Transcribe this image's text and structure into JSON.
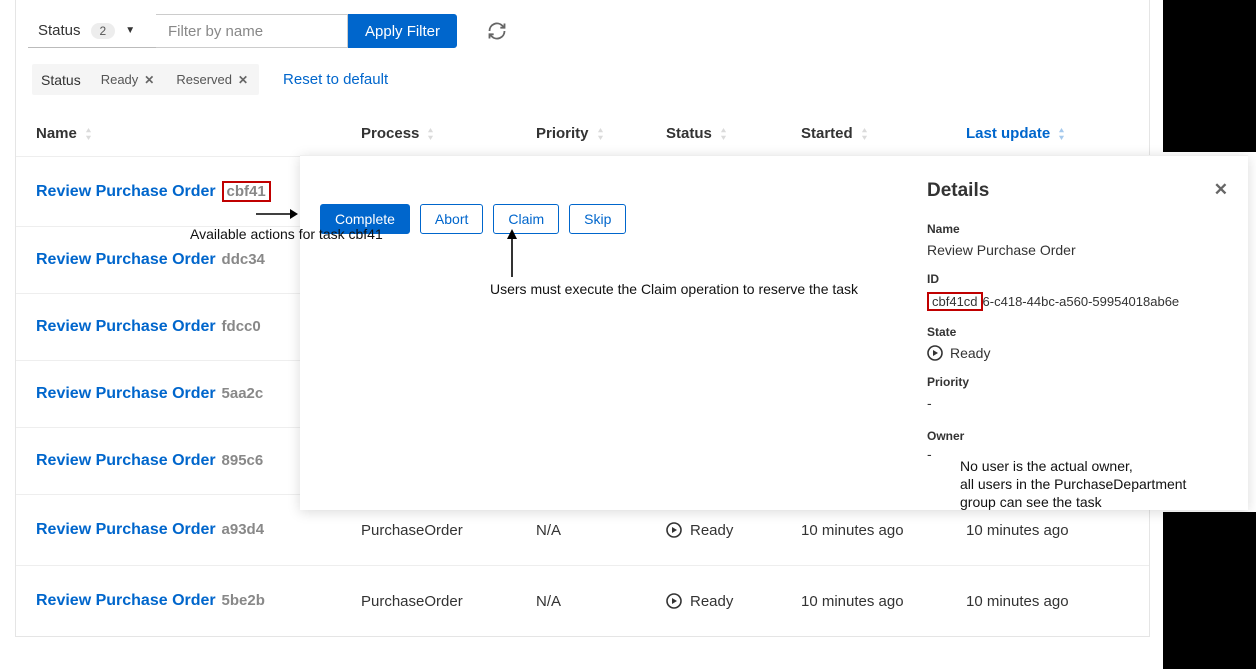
{
  "filters": {
    "status_label": "Status",
    "status_count": "2",
    "name_placeholder": "Filter by name",
    "apply_label": "Apply Filter"
  },
  "chips": {
    "group_label": "Status",
    "ready": "Ready",
    "reserved": "Reserved",
    "reset_label": "Reset to default"
  },
  "columns": {
    "name": "Name",
    "process": "Process",
    "priority": "Priority",
    "status": "Status",
    "started": "Started",
    "updated": "Last update"
  },
  "tasks": [
    {
      "name": "Review Purchase Order",
      "id": "cbf41"
    },
    {
      "name": "Review Purchase Order",
      "id": "ddc34"
    },
    {
      "name": "Review Purchase Order",
      "id": "fdcc0"
    },
    {
      "name": "Review Purchase Order",
      "id": "5aa2c"
    },
    {
      "name": "Review Purchase Order",
      "id": "895c6"
    }
  ],
  "full_rows": [
    {
      "name": "Review Purchase Order",
      "id": "a93d4",
      "process": "PurchaseOrder",
      "priority": "N/A",
      "status": "Ready",
      "started": "10 minutes ago",
      "updated": "10 minutes ago"
    },
    {
      "name": "Review Purchase Order",
      "id": "5be2b",
      "process": "PurchaseOrder",
      "priority": "N/A",
      "status": "Ready",
      "started": "10 minutes ago",
      "updated": "10 minutes ago"
    }
  ],
  "actions": {
    "complete": "Complete",
    "abort": "Abort",
    "claim": "Claim",
    "skip": "Skip"
  },
  "details": {
    "heading": "Details",
    "name_label": "Name",
    "name_value": "Review Purchase Order",
    "id_label": "ID",
    "id_prefix": "cbf41cd",
    "id_rest": "6-c418-44bc-a560-59954018ab6e",
    "state_label": "State",
    "state_value": "Ready",
    "priority_label": "Priority",
    "priority_value": "-",
    "owner_label": "Owner",
    "owner_value": "-"
  },
  "annotations": {
    "a1": "Available actions for task cbf41",
    "a2": "Users must execute the Claim operation to reserve the task",
    "a3_l1": "No user is the actual owner,",
    "a3_l2": "all users in the PurchaseDepartment",
    "a3_l3": "group can see the task"
  }
}
